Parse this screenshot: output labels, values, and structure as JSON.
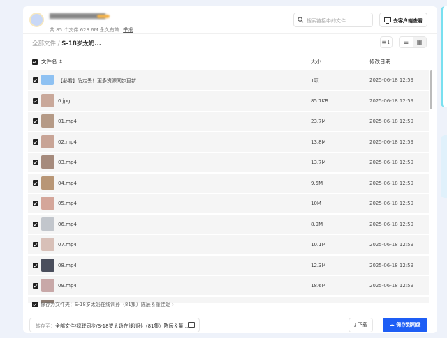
{
  "header": {
    "meta": "共 85 个文件 628.6M  永久有效",
    "report": "举报",
    "search_placeholder": "搜索链接中的文件",
    "client_button": "去客户端查看"
  },
  "breadcrumb": {
    "root": "全部文件",
    "sep": "/",
    "current": "S-18岁太奶..."
  },
  "table": {
    "col_name": "文件名 ⇕",
    "col_size": "大小",
    "col_date": "修改日期",
    "rows": [
      {
        "name": "【必看】防走丢！更多资源同步更新",
        "size": "1项",
        "date": "2025-06-18 12:59",
        "type": "folder"
      },
      {
        "name": "0.jpg",
        "size": "85.7KB",
        "date": "2025-06-18 12:59",
        "type": "image",
        "color": "#c9a89a"
      },
      {
        "name": "01.mp4",
        "size": "23.7M",
        "date": "2025-06-18 12:59",
        "type": "video",
        "color": "#b59a86"
      },
      {
        "name": "02.mp4",
        "size": "13.8M",
        "date": "2025-06-18 12:59",
        "type": "video",
        "color": "#c8a496"
      },
      {
        "name": "03.mp4",
        "size": "13.7M",
        "date": "2025-06-18 12:59",
        "type": "video",
        "color": "#a58a7c"
      },
      {
        "name": "04.mp4",
        "size": "9.5M",
        "date": "2025-06-18 12:59",
        "type": "video",
        "color": "#b89676"
      },
      {
        "name": "05.mp4",
        "size": "10M",
        "date": "2025-06-18 12:59",
        "type": "video",
        "color": "#d4a69a"
      },
      {
        "name": "06.mp4",
        "size": "8.9M",
        "date": "2025-06-18 12:59",
        "type": "video",
        "color": "#c2c6cc"
      },
      {
        "name": "07.mp4",
        "size": "10.1M",
        "date": "2025-06-18 12:59",
        "type": "video",
        "color": "#d8c0b8"
      },
      {
        "name": "08.mp4",
        "size": "12.3M",
        "date": "2025-06-18 12:59",
        "type": "video",
        "color": "#4a4e5c"
      },
      {
        "name": "09.mp4",
        "size": "18.6M",
        "date": "2025-06-18 12:59",
        "type": "video",
        "color": "#c8a8a8"
      },
      {
        "name": "",
        "size": "",
        "date": "",
        "type": "video",
        "color": "#8a7a70"
      }
    ]
  },
  "footer": {
    "save_as_folder": "保存为文件夹：S-18岁太奶在线训孙（81集）陈辰＆董佳妮 ›",
    "dest_label": "转存至：",
    "dest_path": "全部文件/绿联同步/S-18岁太奶在线训孙（81集）陈辰＆董...",
    "download": "下载",
    "save": "保存到网盘"
  }
}
